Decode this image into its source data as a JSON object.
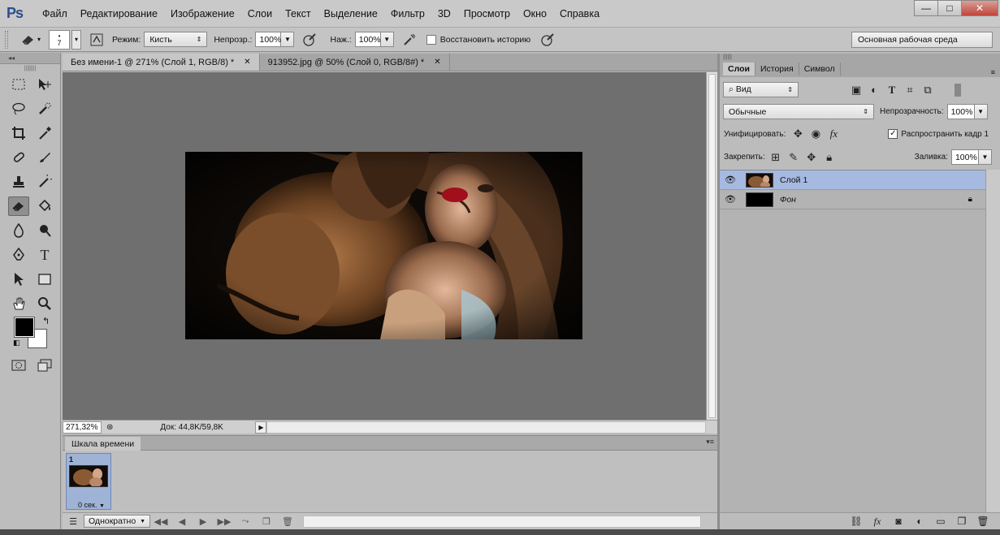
{
  "app": {
    "logo": "Ps"
  },
  "menu": [
    "Файл",
    "Редактирование",
    "Изображение",
    "Слои",
    "Текст",
    "Выделение",
    "Фильтр",
    "3D",
    "Просмотр",
    "Окно",
    "Справка"
  ],
  "window_buttons": {
    "minimize": "—",
    "maximize": "□",
    "close": "✕"
  },
  "options": {
    "brush_size": "7",
    "mode_label": "Режим:",
    "mode_value": "Кисть",
    "opacity_label": "Непрозр.:",
    "opacity_value": "100%",
    "flow_label": "Наж.:",
    "flow_value": "100%",
    "restore_history_label": "Восстановить историю",
    "workspace": "Основная рабочая среда"
  },
  "document_tabs": [
    {
      "label": "Без имени-1 @ 271% (Слой 1, RGB/8) *",
      "active": true
    },
    {
      "label": "913952.jpg @ 50% (Слой 0, RGB/8#) *",
      "active": false
    }
  ],
  "status": {
    "zoom": "271,32%",
    "doc": "Док: 44,8K/59,8K"
  },
  "timeline": {
    "tab": "Шкала времени",
    "frame_number": "1",
    "frame_delay": "0 сек.",
    "loop": "Однократно"
  },
  "right_panel": {
    "tabs": [
      "Слои",
      "История",
      "Символ"
    ],
    "filter_kind": "Вид",
    "blend_mode": "Обычные",
    "opacity_label": "Непрозрачность:",
    "opacity_value": "100%",
    "unify_label": "Унифицировать:",
    "propagate_label": "Распространить кадр 1",
    "lock_label": "Закрепить:",
    "fill_label": "Заливка:",
    "fill_value": "100%",
    "layers": [
      {
        "name": "Слой 1",
        "selected": true
      },
      {
        "name": "Фон",
        "selected": false,
        "locked": true
      }
    ]
  },
  "colors": {
    "accent_selection": "#a6b9e0",
    "canvas_bg": "#6f6f6f",
    "foreground": "#000000",
    "background": "#ffffff"
  }
}
